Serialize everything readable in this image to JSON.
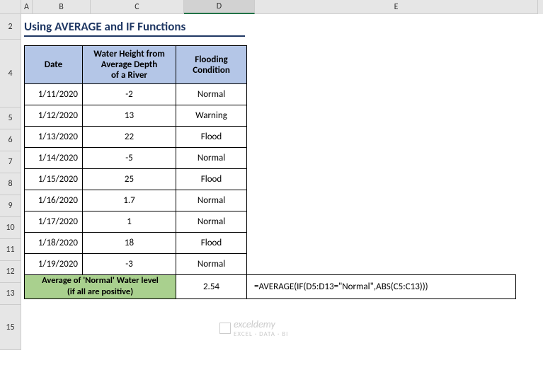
{
  "columns": [
    "A",
    "B",
    "C",
    "D",
    "E"
  ],
  "col_widths": {
    "A": 16,
    "B": 82,
    "C": 132,
    "D": 100,
    "E": 400
  },
  "selected_col": "D",
  "row_headers": [
    2,
    4,
    5,
    6,
    7,
    8,
    9,
    10,
    11,
    12,
    13,
    15
  ],
  "row_heights": {
    "2": 36,
    "4": 96,
    "5": 31,
    "6": 31,
    "7": 31,
    "8": 31,
    "9": 31,
    "10": 31,
    "11": 31,
    "12": 31,
    "13": 31,
    "15": 64
  },
  "title": "Using AVERAGE and IF Functions",
  "headers": {
    "date": "Date",
    "height": "Water Height from Average Depth\nof a River",
    "cond": "Flooding Condition"
  },
  "rows": [
    {
      "date": "1/11/2020",
      "height": "-2",
      "cond": "Normal"
    },
    {
      "date": "1/12/2020",
      "height": "13",
      "cond": "Warning"
    },
    {
      "date": "1/13/2020",
      "height": "22",
      "cond": "Flood"
    },
    {
      "date": "1/14/2020",
      "height": "-5",
      "cond": "Normal"
    },
    {
      "date": "1/15/2020",
      "height": "25",
      "cond": "Flood"
    },
    {
      "date": "1/16/2020",
      "height": "1.7",
      "cond": "Normal"
    },
    {
      "date": "1/17/2020",
      "height": "1",
      "cond": "Normal"
    },
    {
      "date": "1/18/2020",
      "height": "18",
      "cond": "Flood"
    },
    {
      "date": "1/19/2020",
      "height": "-3",
      "cond": "Normal"
    }
  ],
  "footer": {
    "label": "Average of 'Normal' Water level\n(if all are positive)",
    "value": "2.54",
    "formula": "=AVERAGE(IF(D5:D13=\"Normal\",ABS(C5:C13)))"
  },
  "watermark": {
    "main": "exceldemy",
    "sub": "EXCEL · DATA · BI"
  }
}
